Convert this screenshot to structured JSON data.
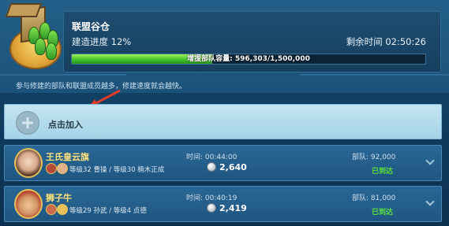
{
  "building": {
    "title": "联盟谷仓",
    "progress_label": "建造进度 12%",
    "time_left": "剩余时间 02:50:26",
    "progress_fraction": 0.12,
    "capacity_text": "增援部队容量: 596,303/1,500,000"
  },
  "hint": "参与修建的部队和联盟成员越多，修建速度就会越快。",
  "join": {
    "label": "点击加入"
  },
  "members": [
    {
      "name": "王氏皇云旗",
      "commanders": "等级32 曹操 / 等级30 楠木正成",
      "time": "时间:    00:44:00",
      "amount": "2,640",
      "troops": "部队: 92,000",
      "status": "已到达"
    },
    {
      "name": "狮子牛",
      "commanders": "等级29 孙武 / 等级4 贞德",
      "time": "时间:    00:40:19",
      "amount": "2,419",
      "troops": "部队: 81,000",
      "status": "已到达"
    }
  ]
}
